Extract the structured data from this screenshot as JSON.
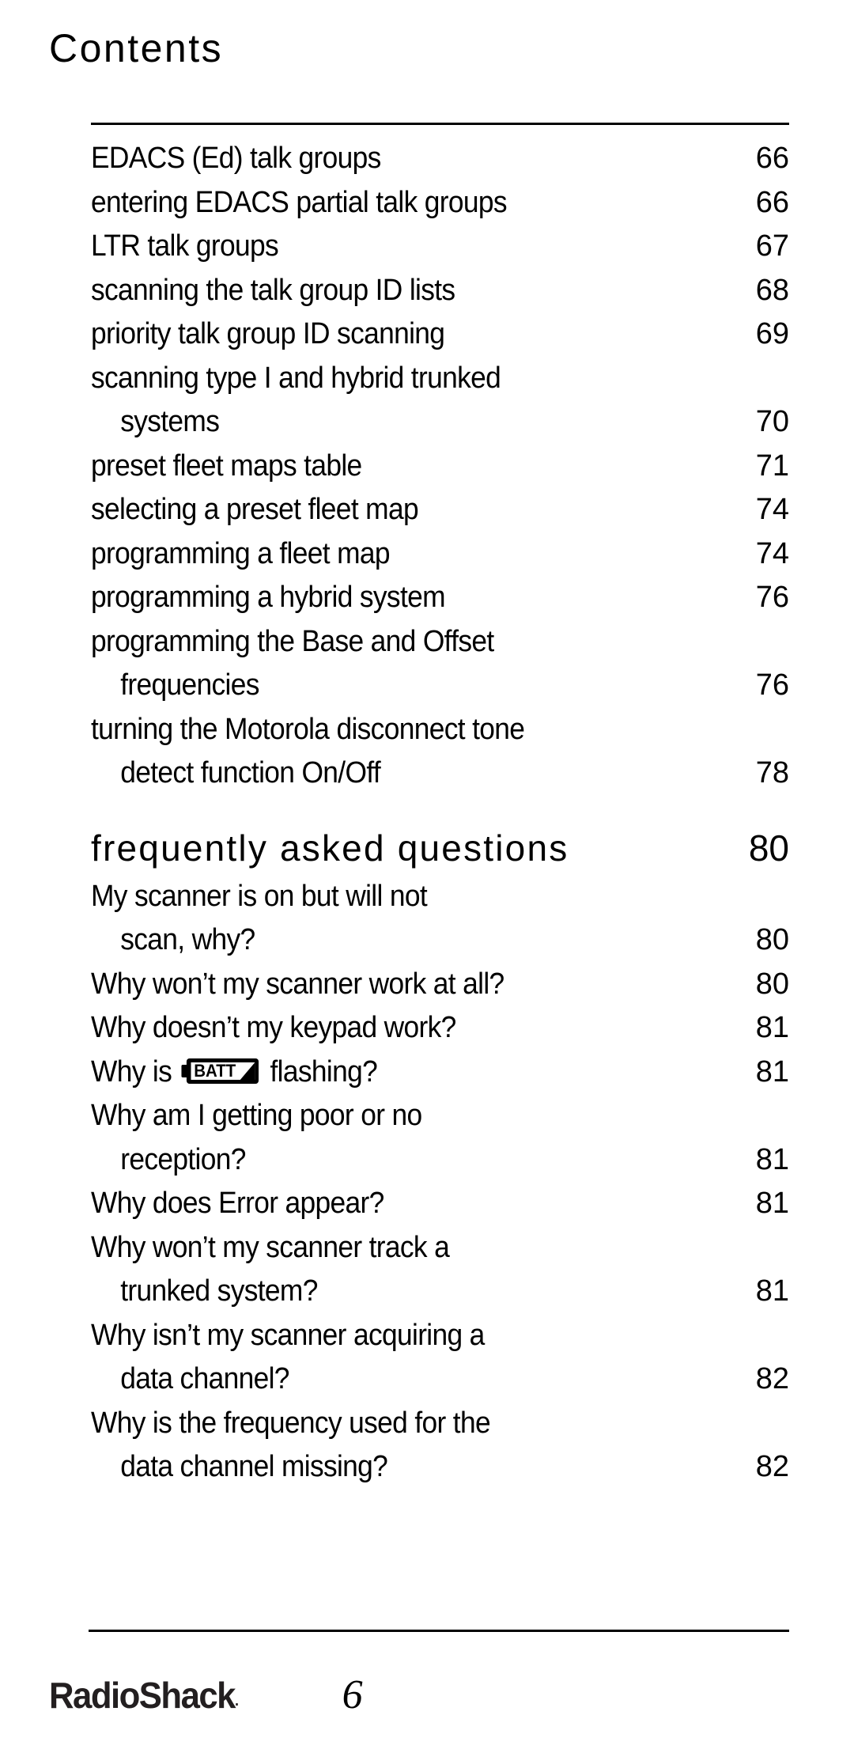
{
  "header": {
    "title": "Contents"
  },
  "toc": {
    "entries": [
      {
        "label": "EDACS (Ed) talk groups",
        "page": "66",
        "indent": false,
        "type": "entry"
      },
      {
        "label": "entering EDACS partial talk groups",
        "page": "66",
        "indent": false,
        "type": "entry"
      },
      {
        "label": "LTR talk groups",
        "page": "67",
        "indent": false,
        "type": "entry"
      },
      {
        "label": "scanning the talk group ID lists",
        "page": "68",
        "indent": false,
        "type": "entry"
      },
      {
        "label": "priority talk group ID scanning",
        "page": "69",
        "indent": false,
        "type": "entry"
      },
      {
        "label": "scanning type I and hybrid trunked",
        "page": "",
        "indent": false,
        "type": "entry"
      },
      {
        "label": "systems",
        "page": "70",
        "indent": true,
        "type": "entry"
      },
      {
        "label": "preset fleet maps table",
        "page": "71",
        "indent": false,
        "type": "entry"
      },
      {
        "label": "selecting a preset fleet map",
        "page": "74",
        "indent": false,
        "type": "entry"
      },
      {
        "label": "programming a fleet map",
        "page": "74",
        "indent": false,
        "type": "entry"
      },
      {
        "label": "programming a hybrid system",
        "page": "76",
        "indent": false,
        "type": "entry"
      },
      {
        "label": "programming the Base and Offset",
        "page": "",
        "indent": false,
        "type": "entry"
      },
      {
        "label": "frequencies",
        "page": "76",
        "indent": true,
        "type": "entry"
      },
      {
        "label": "turning the Motorola disconnect tone",
        "page": "",
        "indent": false,
        "type": "entry"
      },
      {
        "label": "detect function On/Off",
        "page": "78",
        "indent": true,
        "type": "entry"
      }
    ],
    "section_heading": {
      "label": "frequently asked questions",
      "page": "80"
    },
    "faq_entries": [
      {
        "label": "My scanner is on but will not",
        "page": "",
        "indent": false,
        "icon": null
      },
      {
        "label": "scan, why?",
        "page": "80",
        "indent": true,
        "icon": null
      },
      {
        "label": "Why won’t my scanner work at all?",
        "page": "80",
        "indent": false,
        "icon": null
      },
      {
        "label": "Why doesn’t my keypad work?",
        "page": "81",
        "indent": false,
        "icon": null
      },
      {
        "label_before": "Why is",
        "label_after": "flashing?",
        "page": "81",
        "indent": false,
        "icon": "battery-batt-icon",
        "icon_text": "BATT"
      },
      {
        "label": "Why am I getting poor or no",
        "page": "",
        "indent": false,
        "icon": null
      },
      {
        "label": "reception?",
        "page": "81",
        "indent": true,
        "icon": null
      },
      {
        "label": "Why does Error appear?",
        "page": "81",
        "indent": false,
        "icon": null
      },
      {
        "label": "Why won’t my scanner track a",
        "page": "",
        "indent": false,
        "icon": null
      },
      {
        "label": "trunked system?",
        "page": "81",
        "indent": true,
        "icon": null
      },
      {
        "label": "Why isn’t my scanner acquiring a",
        "page": "",
        "indent": false,
        "icon": null
      },
      {
        "label": "data channel?",
        "page": "82",
        "indent": true,
        "icon": null
      },
      {
        "label": "Why is the frequency used for the",
        "page": "",
        "indent": false,
        "icon": null
      },
      {
        "label": "data channel missing?",
        "page": "82",
        "indent": true,
        "icon": null
      }
    ]
  },
  "footer": {
    "logo_text": "RadioShack",
    "logo_mark": ".",
    "page_number": "6"
  },
  "colors": {
    "text": "#000000",
    "logo": "#231f20",
    "rule": "#000000",
    "background": "#ffffff"
  }
}
